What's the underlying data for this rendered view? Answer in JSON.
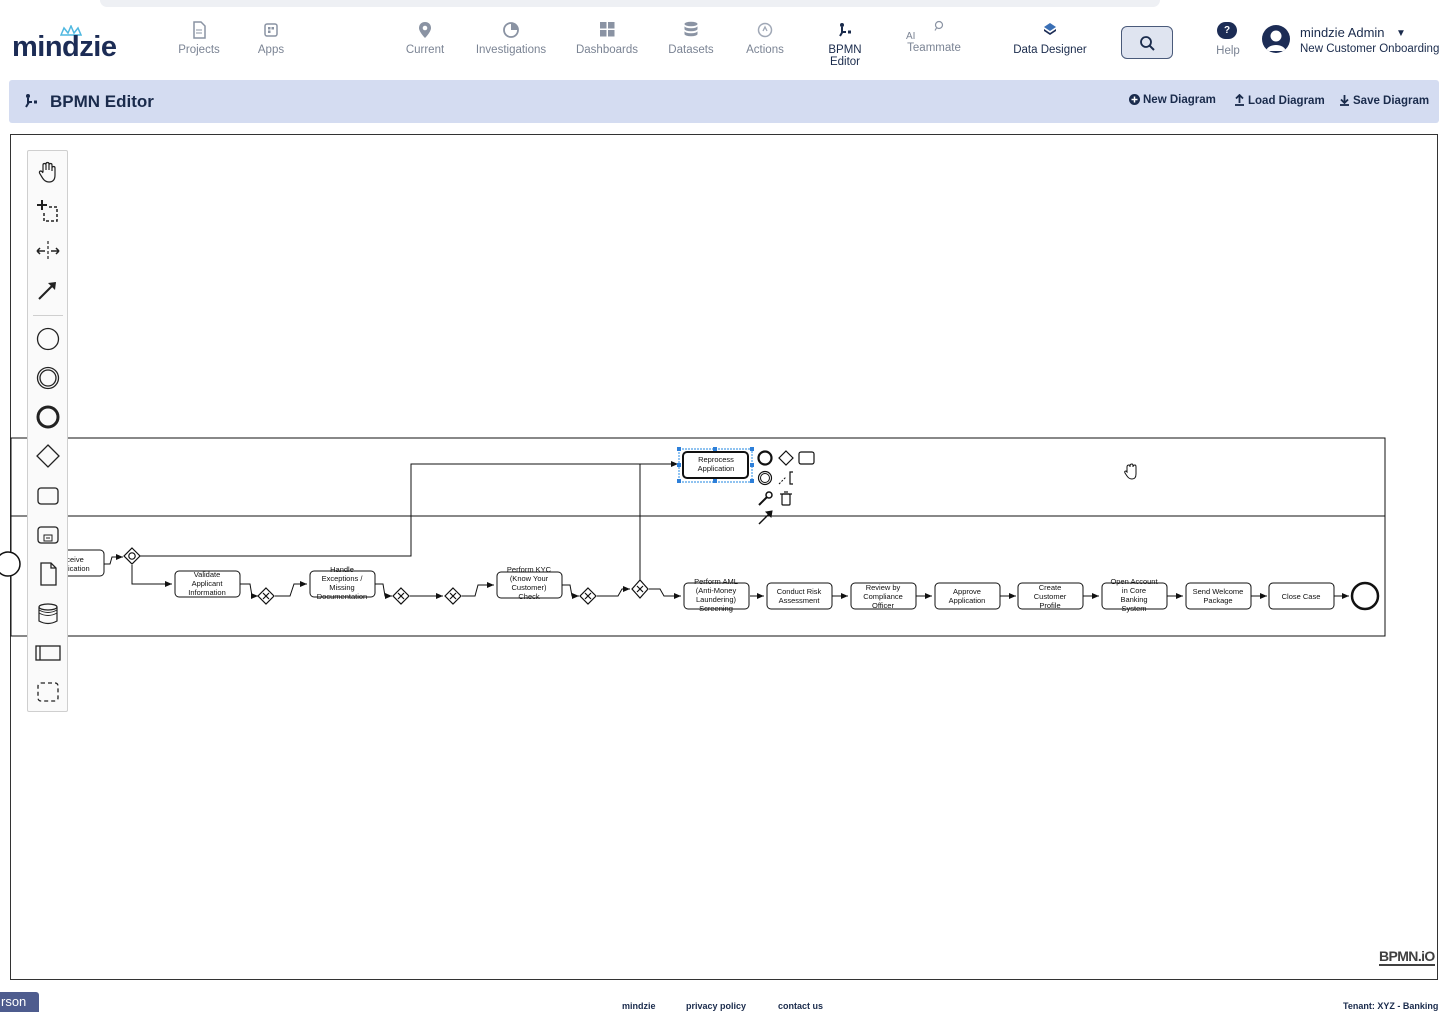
{
  "app": {
    "logo_text": "mindzie"
  },
  "nav": {
    "projects": "Projects",
    "apps": "Apps",
    "current": "Current",
    "investigations": "Investigations",
    "dashboards": "Dashboards",
    "datasets": "Datasets",
    "actions": "Actions",
    "bpmn_editor": "BPMN Editor",
    "ai_teammate_top": "AI",
    "ai_teammate_bottom": "Teammate",
    "data_designer": "Data Designer",
    "help": "Help",
    "help_badge": "?"
  },
  "user": {
    "name": "mindzie Admin",
    "project": "New Customer Onboarding"
  },
  "page": {
    "title": "BPMN Editor",
    "new_diagram": "New Diagram",
    "load_diagram": "Load Diagram",
    "save_diagram": "Save Diagram"
  },
  "diagram": {
    "tasks": {
      "receive_app_1": "ceive",
      "receive_app_2": "lication",
      "validate_1": "Validate",
      "validate_2": "Applicant",
      "validate_3": "Information",
      "handle_1": "Handle",
      "handle_2": "Exceptions /",
      "handle_3": "Missing",
      "handle_4": "Documentation",
      "kyc_1": "Perform KYC",
      "kyc_2": "(Know Your",
      "kyc_3": "Customer)",
      "kyc_4": "Check",
      "aml_1": "Perform AML",
      "aml_2": "(Anti-Money",
      "aml_3": "Laundering)",
      "aml_4": "Screening",
      "risk_1": "Conduct Risk",
      "risk_2": "Assessment",
      "review_1": "Review by",
      "review_2": "Compliance",
      "review_3": "Officer",
      "approve_1": "Approve",
      "approve_2": "Application",
      "create_1": "Create",
      "create_2": "Customer",
      "create_3": "Profile",
      "open_1": "Open Account",
      "open_2": "in Core",
      "open_3": "Banking",
      "open_4": "System",
      "welcome_1": "Send Welcome",
      "welcome_2": "Package",
      "close": "Close Case",
      "reprocess_1": "Reprocess",
      "reprocess_2": "Application"
    },
    "watermark": "BPMN.iO"
  },
  "footer": {
    "side_tab": "rson",
    "link_mindzie": "mindzie",
    "link_privacy": "privacy policy",
    "link_contact": "contact us",
    "tenant": "Tenant: XYZ - Banking"
  }
}
